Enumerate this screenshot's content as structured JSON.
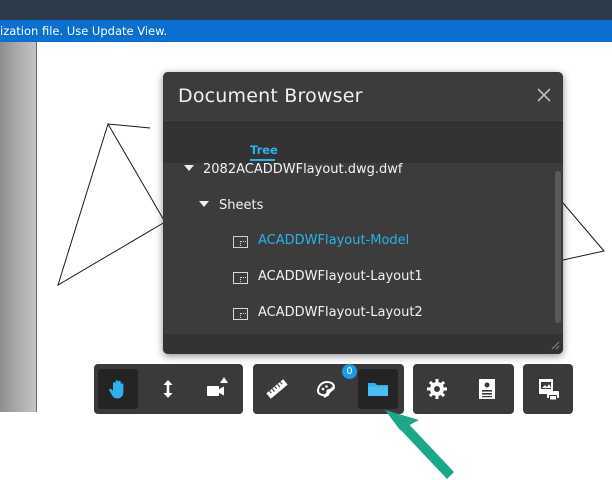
{
  "infobar": {
    "text": "ization file. Use Update View."
  },
  "panel": {
    "title": "Document Browser",
    "tabs": [
      {
        "label": "Tree",
        "active": true
      }
    ],
    "tree": {
      "root": {
        "label": "2082ACADDWFlayout.dwg.dwf",
        "expanded": true
      },
      "folder": {
        "label": "Sheets",
        "expanded": true
      },
      "sheets": [
        {
          "label": "ACADDWFlayout-Model",
          "active": true
        },
        {
          "label": "ACADDWFlayout-Layout1",
          "active": false
        },
        {
          "label": "ACADDWFlayout-Layout2",
          "active": false
        }
      ]
    }
  },
  "toolbar": {
    "groups": [
      {
        "tools": [
          "pan-icon",
          "zoom-icon",
          "camera-icon"
        ]
      },
      {
        "tools": [
          "measure-icon",
          "markup-icon",
          "document-browser-icon"
        ]
      },
      {
        "tools": [
          "settings-icon",
          "properties-icon"
        ]
      },
      {
        "tools": [
          "print-icon"
        ]
      }
    ],
    "markup_badge": "0",
    "active_tool": "document-browser-icon"
  },
  "colors": {
    "accent": "#2bb2ee",
    "infobar": "#0a6fd0",
    "panel_bg": "#3c3c3c",
    "toolbar_bg": "#3a3a3a",
    "callout_arrow": "#1aa888"
  }
}
